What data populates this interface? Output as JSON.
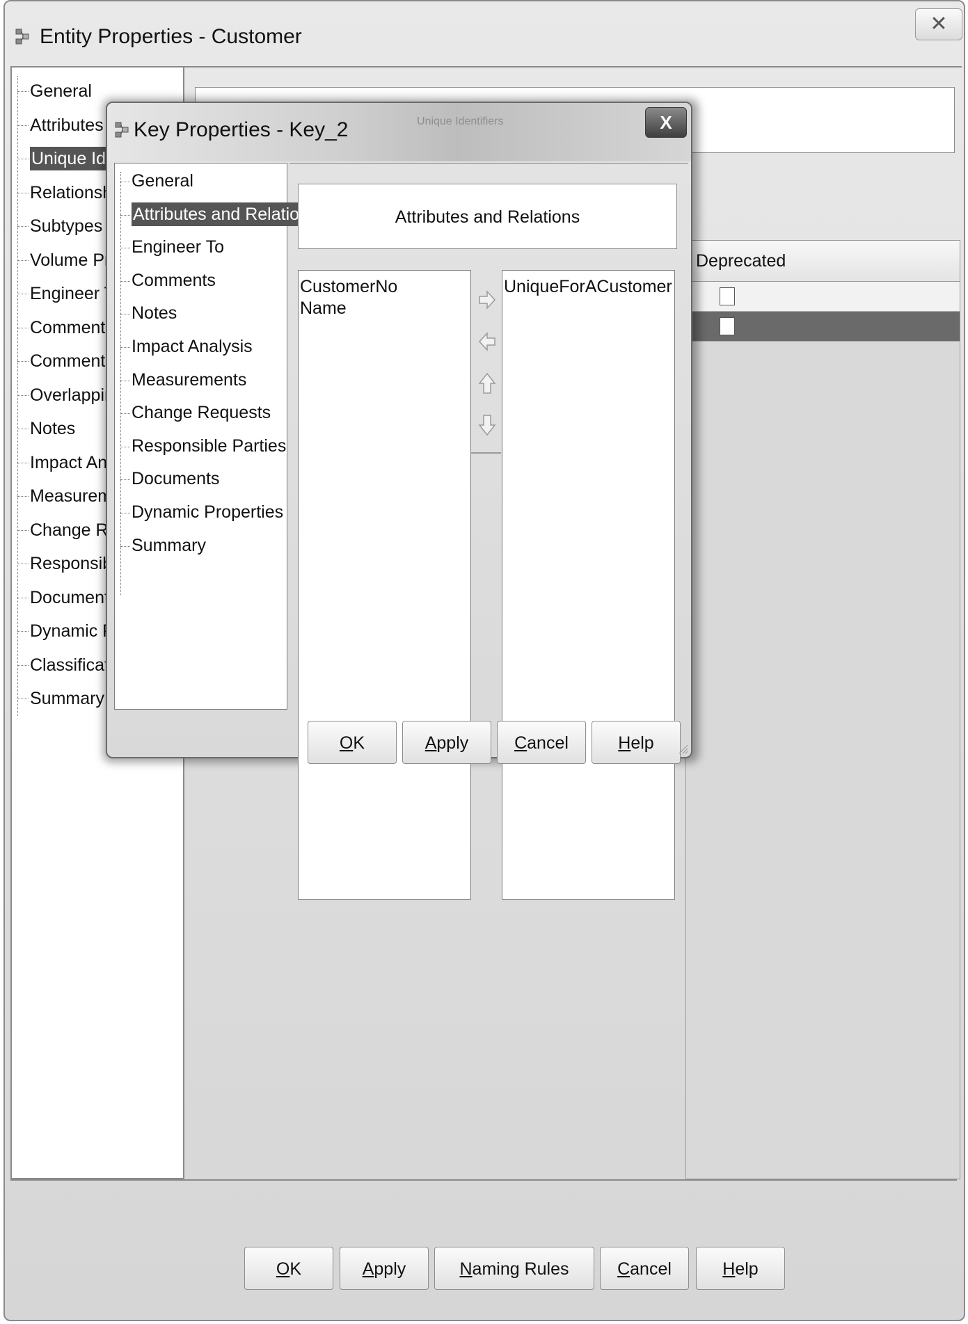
{
  "outer_dialog": {
    "title": "Entity Properties - Customer",
    "close_glyph": "✕",
    "icon": "entity-icon",
    "nav_items": [
      {
        "label": "General",
        "selected": false
      },
      {
        "label": "Attributes",
        "selected": false
      },
      {
        "label": "Unique Identifiers",
        "selected": true
      },
      {
        "label": "Relationships",
        "selected": false
      },
      {
        "label": "Subtypes",
        "selected": false
      },
      {
        "label": "Volume Properties",
        "selected": false
      },
      {
        "label": "Engineer To",
        "selected": false
      },
      {
        "label": "Comments",
        "selected": false
      },
      {
        "label": "Comments in RDBMS",
        "selected": false
      },
      {
        "label": "Overlapping Attributes",
        "selected": false
      },
      {
        "label": "Notes",
        "selected": false
      },
      {
        "label": "Impact Analysis",
        "selected": false
      },
      {
        "label": "Measurements",
        "selected": false
      },
      {
        "label": "Change Requests",
        "selected": false
      },
      {
        "label": "Responsible Parties",
        "selected": false
      },
      {
        "label": "Documents",
        "selected": false
      },
      {
        "label": "Dynamic Properties",
        "selected": false
      },
      {
        "label": "Classification Types",
        "selected": false
      },
      {
        "label": "Summary",
        "selected": false
      }
    ],
    "header_text": "Unique Identifiers",
    "grid": {
      "column_header": "Deprecated",
      "rows": [
        {
          "checked": false,
          "selected": false
        },
        {
          "checked": false,
          "selected": true
        }
      ]
    },
    "buttons": {
      "ok": {
        "mnemonic": "O",
        "rest": "K"
      },
      "apply": {
        "mnemonic": "A",
        "rest": "pply"
      },
      "naming_rules": {
        "mnemonic": "N",
        "rest": "aming Rules"
      },
      "cancel": {
        "mnemonic": "C",
        "rest": "ancel"
      },
      "help": {
        "mnemonic": "H",
        "rest": "elp"
      }
    }
  },
  "inner_dialog": {
    "title": "Key Properties - Key_2",
    "close_glyph": "X",
    "icon": "key-icon",
    "faint_title_text": "Unique Identifiers",
    "nav_items": [
      {
        "label": "General",
        "selected": false
      },
      {
        "label": "Attributes and Relations",
        "selected": true
      },
      {
        "label": "Engineer To",
        "selected": false
      },
      {
        "label": "Comments",
        "selected": false
      },
      {
        "label": "Notes",
        "selected": false
      },
      {
        "label": "Impact Analysis",
        "selected": false
      },
      {
        "label": "Measurements",
        "selected": false
      },
      {
        "label": "Change Requests",
        "selected": false
      },
      {
        "label": "Responsible Parties",
        "selected": false
      },
      {
        "label": "Documents",
        "selected": false
      },
      {
        "label": "Dynamic Properties",
        "selected": false
      },
      {
        "label": "Summary",
        "selected": false
      }
    ],
    "header_text": "Attributes and Relations",
    "available_items": [
      "CustomerNo",
      "Name"
    ],
    "selected_items": [
      "UniqueForACustomer"
    ],
    "arrow_icons": [
      "arrow-right-icon",
      "arrow-left-icon",
      "arrow-up-icon",
      "arrow-down-icon"
    ],
    "buttons": {
      "ok": {
        "mnemonic": "O",
        "rest": "K"
      },
      "apply": {
        "mnemonic": "A",
        "rest": "pply"
      },
      "cancel": {
        "mnemonic": "C",
        "rest": "ancel"
      },
      "help": {
        "mnemonic": "H",
        "rest": "elp"
      }
    }
  }
}
